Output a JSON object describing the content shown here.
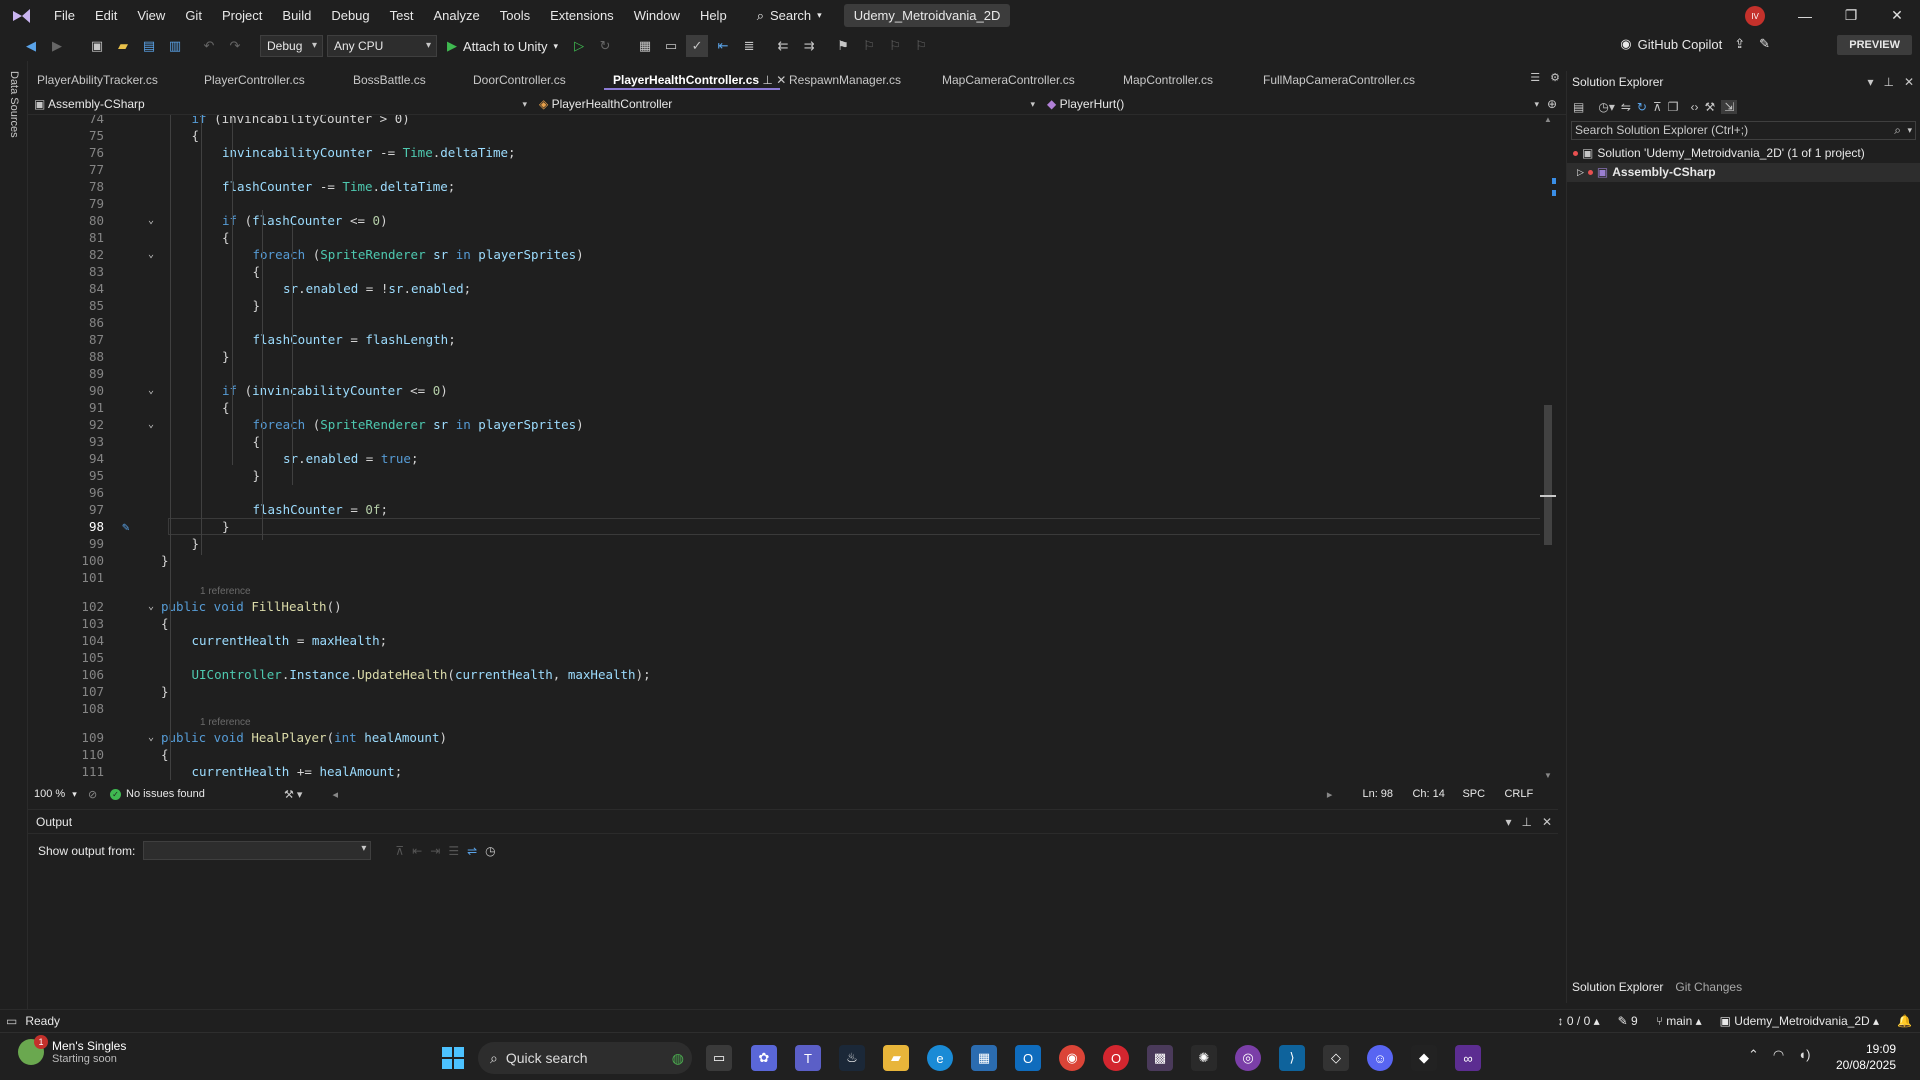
{
  "menu": {
    "items": [
      "File",
      "Edit",
      "View",
      "Git",
      "Project",
      "Build",
      "Debug",
      "Test",
      "Analyze",
      "Tools",
      "Extensions",
      "Window",
      "Help"
    ],
    "search_label": "Search",
    "solution_title": "Udemy_Metroidvania_2D",
    "avatar_initials": "IV"
  },
  "toolbar": {
    "config": "Debug",
    "platform": "Any CPU",
    "attach_label": "Attach to Unity",
    "copilot_label": "GitHub Copilot",
    "preview_label": "PREVIEW"
  },
  "left_strip": {
    "label": "Data Sources"
  },
  "tabs": [
    {
      "label": "PlayerAbilityTracker.cs",
      "active": false
    },
    {
      "label": "PlayerController.cs",
      "active": false
    },
    {
      "label": "BossBattle.cs",
      "active": false
    },
    {
      "label": "DoorController.cs",
      "active": false
    },
    {
      "label": "PlayerHealthController.cs",
      "active": true
    },
    {
      "label": "RespawnManager.cs",
      "active": false
    },
    {
      "label": "MapCameraController.cs",
      "active": false
    },
    {
      "label": "MapController.cs",
      "active": false
    },
    {
      "label": "FullMapCameraController.cs",
      "active": false
    }
  ],
  "navbar": {
    "project": "Assembly-CSharp",
    "class": "PlayerHealthController",
    "member": "PlayerHurt()"
  },
  "editor": {
    "current_line": "98",
    "lines": [
      {
        "n": "74",
        "indent": 2,
        "tokens": [
          [
            "kw",
            "if "
          ],
          [
            "pl",
            "(invincabilityCounter > 0)"
          ]
        ]
      },
      {
        "n": "75",
        "indent": 2,
        "tokens": [
          [
            "pl",
            "{"
          ]
        ]
      },
      {
        "n": "76",
        "indent": 3,
        "tokens": [
          [
            "var",
            "invincabilityCounter"
          ],
          [
            "pl",
            " -= "
          ],
          [
            "ty",
            "Time"
          ],
          [
            "pl",
            "."
          ],
          [
            "var",
            "deltaTime"
          ],
          [
            "pl",
            ";"
          ]
        ]
      },
      {
        "n": "77",
        "indent": 3,
        "tokens": []
      },
      {
        "n": "78",
        "indent": 3,
        "tokens": [
          [
            "var",
            "flashCounter"
          ],
          [
            "pl",
            " -= "
          ],
          [
            "ty",
            "Time"
          ],
          [
            "pl",
            "."
          ],
          [
            "var",
            "deltaTime"
          ],
          [
            "pl",
            ";"
          ]
        ]
      },
      {
        "n": "79",
        "indent": 3,
        "tokens": []
      },
      {
        "n": "80",
        "indent": 3,
        "fold": true,
        "tokens": [
          [
            "kw",
            "if "
          ],
          [
            "pl",
            "("
          ],
          [
            "var",
            "flashCounter"
          ],
          [
            "pl",
            " <= "
          ],
          [
            "num",
            "0"
          ],
          [
            "pl",
            ")"
          ]
        ]
      },
      {
        "n": "81",
        "indent": 3,
        "tokens": [
          [
            "pl",
            "{"
          ]
        ]
      },
      {
        "n": "82",
        "indent": 4,
        "fold": true,
        "tokens": [
          [
            "kw",
            "foreach "
          ],
          [
            "pl",
            "("
          ],
          [
            "ty",
            "SpriteRenderer"
          ],
          [
            "var",
            " sr "
          ],
          [
            "kw",
            "in "
          ],
          [
            "var",
            "playerSprites"
          ],
          [
            "pl",
            ")"
          ]
        ]
      },
      {
        "n": "83",
        "indent": 4,
        "tokens": [
          [
            "pl",
            "{"
          ]
        ]
      },
      {
        "n": "84",
        "indent": 5,
        "tokens": [
          [
            "var",
            "sr"
          ],
          [
            "pl",
            "."
          ],
          [
            "var",
            "enabled"
          ],
          [
            "pl",
            " = !"
          ],
          [
            "var",
            "sr"
          ],
          [
            "pl",
            "."
          ],
          [
            "var",
            "enabled"
          ],
          [
            "pl",
            ";"
          ]
        ]
      },
      {
        "n": "85",
        "indent": 4,
        "tokens": [
          [
            "pl",
            "}"
          ]
        ]
      },
      {
        "n": "86",
        "indent": 4,
        "tokens": []
      },
      {
        "n": "87",
        "indent": 4,
        "tokens": [
          [
            "var",
            "flashCounter"
          ],
          [
            "pl",
            " = "
          ],
          [
            "var",
            "flashLength"
          ],
          [
            "pl",
            ";"
          ]
        ]
      },
      {
        "n": "88",
        "indent": 3,
        "tokens": [
          [
            "pl",
            "}"
          ]
        ]
      },
      {
        "n": "89",
        "indent": 3,
        "tokens": []
      },
      {
        "n": "90",
        "indent": 3,
        "fold": true,
        "tokens": [
          [
            "kw",
            "if "
          ],
          [
            "pl",
            "("
          ],
          [
            "var",
            "invincabilityCounter"
          ],
          [
            "pl",
            " <= "
          ],
          [
            "num",
            "0"
          ],
          [
            "pl",
            ")"
          ]
        ]
      },
      {
        "n": "91",
        "indent": 3,
        "tokens": [
          [
            "pl",
            "{"
          ]
        ]
      },
      {
        "n": "92",
        "indent": 4,
        "fold": true,
        "tokens": [
          [
            "kw",
            "foreach "
          ],
          [
            "pl",
            "("
          ],
          [
            "ty",
            "SpriteRenderer"
          ],
          [
            "var",
            " sr "
          ],
          [
            "kw",
            "in "
          ],
          [
            "var",
            "playerSprites"
          ],
          [
            "pl",
            ")"
          ]
        ]
      },
      {
        "n": "93",
        "indent": 4,
        "tokens": [
          [
            "pl",
            "{"
          ]
        ]
      },
      {
        "n": "94",
        "indent": 5,
        "tokens": [
          [
            "var",
            "sr"
          ],
          [
            "pl",
            "."
          ],
          [
            "var",
            "enabled"
          ],
          [
            "pl",
            " = "
          ],
          [
            "kw",
            "true"
          ],
          [
            "pl",
            ";"
          ]
        ]
      },
      {
        "n": "95",
        "indent": 4,
        "tokens": [
          [
            "pl",
            "}"
          ]
        ]
      },
      {
        "n": "96",
        "indent": 4,
        "tokens": []
      },
      {
        "n": "97",
        "indent": 4,
        "tokens": [
          [
            "var",
            "flashCounter"
          ],
          [
            "pl",
            " = "
          ],
          [
            "num",
            "0f"
          ],
          [
            "pl",
            ";"
          ]
        ]
      },
      {
        "n": "98",
        "indent": 3,
        "tokens": [
          [
            "pl",
            "}"
          ]
        ]
      },
      {
        "n": "99",
        "indent": 2,
        "tokens": [
          [
            "pl",
            "}"
          ]
        ]
      },
      {
        "n": "100",
        "indent": 1,
        "tokens": [
          [
            "pl",
            "}"
          ]
        ]
      },
      {
        "n": "101",
        "indent": 1,
        "tokens": []
      },
      {
        "n": "102",
        "indent": 1,
        "fold": true,
        "ref": "1 reference",
        "tokens": [
          [
            "kw",
            "public void "
          ],
          [
            "fn",
            "FillHealth"
          ],
          [
            "pl",
            "()"
          ]
        ]
      },
      {
        "n": "103",
        "indent": 1,
        "tokens": [
          [
            "pl",
            "{"
          ]
        ]
      },
      {
        "n": "104",
        "indent": 2,
        "tokens": [
          [
            "var",
            "currentHealth"
          ],
          [
            "pl",
            " = "
          ],
          [
            "var",
            "maxHealth"
          ],
          [
            "pl",
            ";"
          ]
        ]
      },
      {
        "n": "105",
        "indent": 2,
        "tokens": []
      },
      {
        "n": "106",
        "indent": 2,
        "tokens": [
          [
            "ty",
            "UIController"
          ],
          [
            "pl",
            "."
          ],
          [
            "var",
            "Instance"
          ],
          [
            "pl",
            "."
          ],
          [
            "fn",
            "UpdateHealth"
          ],
          [
            "pl",
            "("
          ],
          [
            "var",
            "currentHealth"
          ],
          [
            "pl",
            ", "
          ],
          [
            "var",
            "maxHealth"
          ],
          [
            "pl",
            ");"
          ]
        ]
      },
      {
        "n": "107",
        "indent": 1,
        "tokens": [
          [
            "pl",
            "}"
          ]
        ]
      },
      {
        "n": "108",
        "indent": 1,
        "tokens": []
      },
      {
        "n": "109",
        "indent": 1,
        "fold": true,
        "ref": "1 reference",
        "tokens": [
          [
            "kw",
            "public void "
          ],
          [
            "fn",
            "HealPlayer"
          ],
          [
            "pl",
            "("
          ],
          [
            "kw",
            "int "
          ],
          [
            "var",
            "healAmount"
          ],
          [
            "pl",
            ")"
          ]
        ]
      },
      {
        "n": "110",
        "indent": 1,
        "tokens": [
          [
            "pl",
            "{"
          ]
        ]
      },
      {
        "n": "111",
        "indent": 2,
        "tokens": [
          [
            "var",
            "currentHealth"
          ],
          [
            "pl",
            " += "
          ],
          [
            "var",
            "healAmount"
          ],
          [
            "pl",
            ";"
          ]
        ]
      }
    ]
  },
  "edstatus": {
    "zoom": "100 %",
    "issues": "No issues found",
    "ln": "Ln: 98",
    "ch": "Ch: 14",
    "spc": "SPC",
    "crlf": "CRLF"
  },
  "output": {
    "title": "Output",
    "show_from": "Show output from:"
  },
  "solution": {
    "title": "Solution Explorer",
    "search_placeholder": "Search Solution Explorer (Ctrl+;)",
    "solution_node": "Solution 'Udemy_Metroidvania_2D' (1 of 1 project)",
    "project_node": "Assembly-CSharp",
    "tab_solution": "Solution Explorer",
    "tab_git": "Git Changes"
  },
  "statusbar": {
    "ready": "Ready",
    "git_sync": "0 / 0",
    "edits": "9",
    "branch": "main",
    "repo": "Udemy_Metroidvania_2D"
  },
  "taskbar": {
    "widget_title": "Men's Singles",
    "widget_sub": "Starting soon",
    "widget_badge": "1",
    "search_placeholder": "Quick search",
    "time": "19:09",
    "date": "20/08/2025"
  }
}
